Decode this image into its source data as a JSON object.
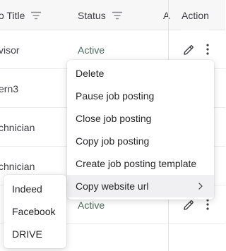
{
  "table": {
    "headers": {
      "title": "o Title",
      "status": "Status",
      "partial": "A",
      "action": "Action"
    },
    "rows": [
      {
        "title": "visor",
        "status": "Active"
      },
      {
        "title": "ern3",
        "status": ""
      },
      {
        "title": "chnician",
        "status": ""
      },
      {
        "title": "chnician",
        "status": ""
      },
      {
        "title": "",
        "status": "Active"
      }
    ]
  },
  "menu": {
    "items": [
      "Delete",
      "Pause job posting",
      "Close job posting",
      "Copy job posting",
      "Create job posting template",
      "Copy website url"
    ],
    "active_index": 5
  },
  "submenu": {
    "items": [
      "Indeed",
      "Facebook",
      "DRIVE"
    ]
  },
  "icons": {
    "filter": "filter-lines-icon",
    "edit": "pencil-icon",
    "more": "kebab-icon",
    "submenu": "chevron-right-icon"
  },
  "colors": {
    "header_bg": "#f7f7f8",
    "status_active": "#4a6b57",
    "menu_active_bg": "#f0f0f2",
    "border": "#e4e4e7"
  }
}
